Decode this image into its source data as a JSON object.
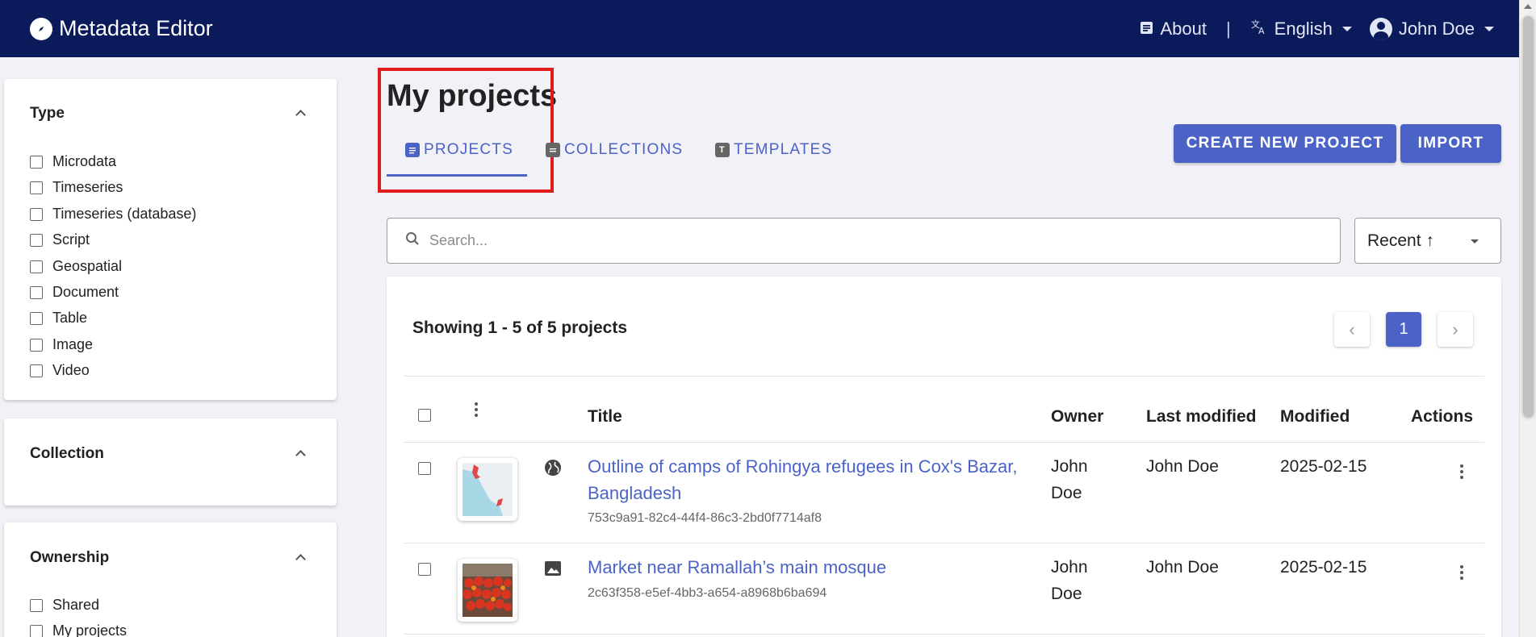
{
  "app": {
    "title": "Metadata Editor"
  },
  "topnav": {
    "about": "About",
    "separator": "|",
    "language": "English",
    "user": "John Doe"
  },
  "sidebar": {
    "type": {
      "title": "Type",
      "options": [
        "Microdata",
        "Timeseries",
        "Timeseries (database)",
        "Script",
        "Geospatial",
        "Document",
        "Table",
        "Image",
        "Video"
      ]
    },
    "collection": {
      "title": "Collection"
    },
    "ownership": {
      "title": "Ownership",
      "options": [
        "Shared",
        "My projects"
      ]
    }
  },
  "main": {
    "title": "My projects",
    "tabs": [
      {
        "label": "PROJECTS",
        "icon": "document-icon"
      },
      {
        "label": "COLLECTIONS",
        "icon": "collection-icon"
      },
      {
        "label": "TEMPLATES",
        "icon": "template-icon"
      }
    ],
    "buttons": {
      "create": "CREATE NEW PROJECT",
      "import": "IMPORT"
    },
    "search": {
      "placeholder": "Search..."
    },
    "sort": {
      "value": "Recent ↑"
    },
    "list": {
      "showing": "Showing 1 - 5 of 5 projects",
      "pagination": {
        "prev": "‹",
        "current": "1",
        "next": "›"
      },
      "columns": {
        "title": "Title",
        "owner": "Owner",
        "last_modified": "Last modified",
        "modified": "Modified",
        "actions": "Actions"
      },
      "rows": [
        {
          "type_icon": "globe-icon",
          "title_line1": "Outline of camps of Rohingya refugees in Cox's Bazar,",
          "title_line2": "Bangladesh",
          "id": "753c9a91-82c4-44f4-86c3-2bd0f7714af8",
          "owner_line1": "John",
          "owner_line2": "Doe",
          "last_modified": "John Doe",
          "modified": "2025-02-15"
        },
        {
          "type_icon": "image-icon",
          "title_line1": "Market near Ramallah’s main mosque",
          "id": "2c63f358-e5ef-4bb3-a654-a8968b6ba694",
          "owner_line1": "John",
          "owner_line2": "Doe",
          "last_modified": "John Doe",
          "modified": "2025-02-15"
        }
      ]
    }
  },
  "colors": {
    "navbar": "#0b1a5a",
    "accent": "#4b63c6",
    "highlight": "#e01b1b",
    "background": "#f1f1f7"
  }
}
